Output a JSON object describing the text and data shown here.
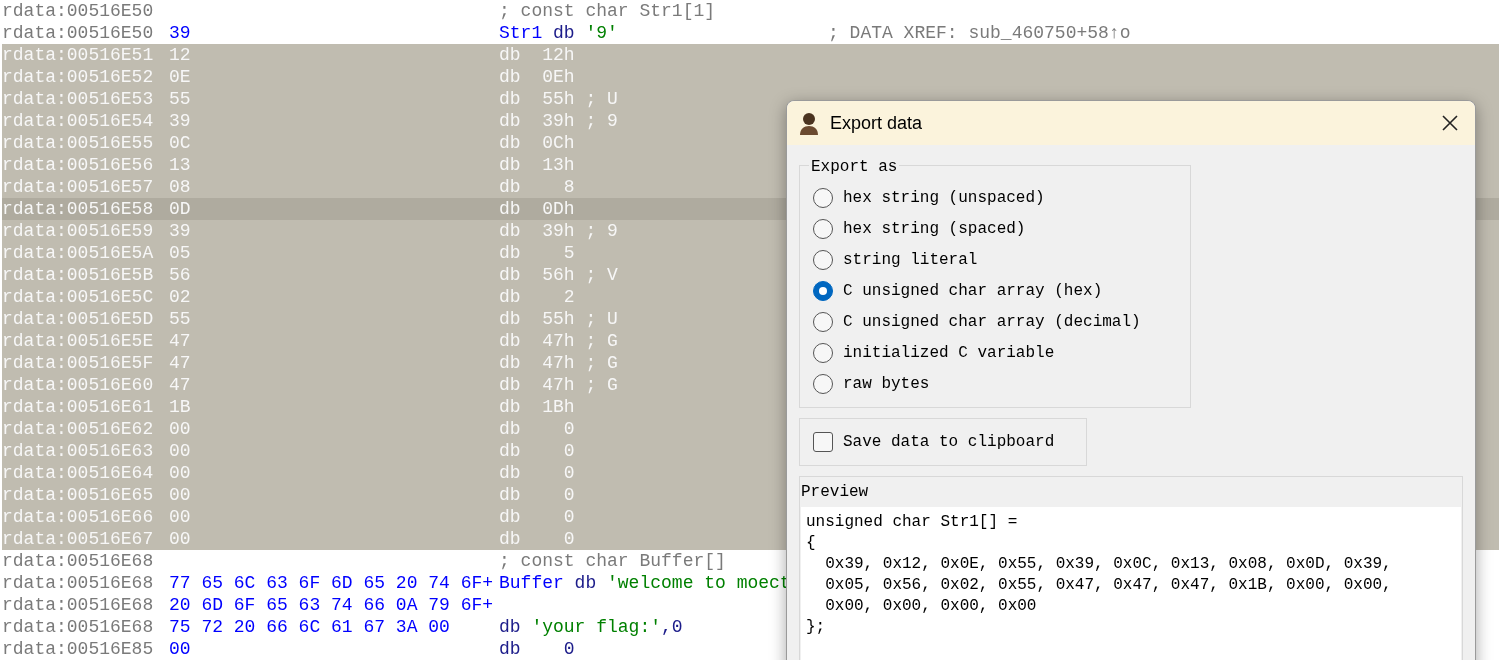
{
  "listing": {
    "rows": [
      {
        "kind": "comment",
        "address": "rdata:00516E50",
        "comment": "; const char Str1[1]",
        "selected": false,
        "current": false
      },
      {
        "kind": "labeled",
        "address": "rdata:00516E50",
        "bytes": "39",
        "label": "Str1",
        "directive": "db",
        "tokens": [
          {
            "text": "'9'",
            "kind": "string"
          }
        ],
        "xref": "; DATA XREF: sub_460750+58↑o",
        "selected": false,
        "current": false
      },
      {
        "kind": "byte",
        "address": "rdata:00516E51",
        "bytes": "12",
        "directive": "db",
        "operand": "12h",
        "selected": true,
        "current": false
      },
      {
        "kind": "byte",
        "address": "rdata:00516E52",
        "bytes": "0E",
        "directive": "db",
        "operand": "0Eh",
        "selected": true,
        "current": false
      },
      {
        "kind": "byte",
        "address": "rdata:00516E53",
        "bytes": "55",
        "directive": "db",
        "operand": "55h",
        "comment": "; U",
        "selected": true,
        "current": false
      },
      {
        "kind": "byte",
        "address": "rdata:00516E54",
        "bytes": "39",
        "directive": "db",
        "operand": "39h",
        "comment": "; 9",
        "selected": true,
        "current": false
      },
      {
        "kind": "byte",
        "address": "rdata:00516E55",
        "bytes": "0C",
        "directive": "db",
        "operand": "0Ch",
        "selected": true,
        "current": false
      },
      {
        "kind": "byte",
        "address": "rdata:00516E56",
        "bytes": "13",
        "directive": "db",
        "operand": "13h",
        "selected": true,
        "current": false
      },
      {
        "kind": "byte",
        "address": "rdata:00516E57",
        "bytes": "08",
        "directive": "db",
        "operand": "8",
        "selected": true,
        "current": false
      },
      {
        "kind": "byte",
        "address": "rdata:00516E58",
        "bytes": "0D",
        "directive": "db",
        "operand": "0Dh",
        "selected": true,
        "current": true
      },
      {
        "kind": "byte",
        "address": "rdata:00516E59",
        "bytes": "39",
        "directive": "db",
        "operand": "39h",
        "comment": "; 9",
        "selected": true,
        "current": false
      },
      {
        "kind": "byte",
        "address": "rdata:00516E5A",
        "bytes": "05",
        "directive": "db",
        "operand": "5",
        "selected": true,
        "current": false
      },
      {
        "kind": "byte",
        "address": "rdata:00516E5B",
        "bytes": "56",
        "directive": "db",
        "operand": "56h",
        "comment": "; V",
        "selected": true,
        "current": false
      },
      {
        "kind": "byte",
        "address": "rdata:00516E5C",
        "bytes": "02",
        "directive": "db",
        "operand": "2",
        "selected": true,
        "current": false
      },
      {
        "kind": "byte",
        "address": "rdata:00516E5D",
        "bytes": "55",
        "directive": "db",
        "operand": "55h",
        "comment": "; U",
        "selected": true,
        "current": false
      },
      {
        "kind": "byte",
        "address": "rdata:00516E5E",
        "bytes": "47",
        "directive": "db",
        "operand": "47h",
        "comment": "; G",
        "selected": true,
        "current": false
      },
      {
        "kind": "byte",
        "address": "rdata:00516E5F",
        "bytes": "47",
        "directive": "db",
        "operand": "47h",
        "comment": "; G",
        "selected": true,
        "current": false
      },
      {
        "kind": "byte",
        "address": "rdata:00516E60",
        "bytes": "47",
        "directive": "db",
        "operand": "47h",
        "comment": "; G",
        "selected": true,
        "current": false
      },
      {
        "kind": "byte",
        "address": "rdata:00516E61",
        "bytes": "1B",
        "directive": "db",
        "operand": "1Bh",
        "selected": true,
        "current": false
      },
      {
        "kind": "byte",
        "address": "rdata:00516E62",
        "bytes": "00",
        "directive": "db",
        "operand": "0",
        "selected": true,
        "current": false
      },
      {
        "kind": "byte",
        "address": "rdata:00516E63",
        "bytes": "00",
        "directive": "db",
        "operand": "0",
        "selected": true,
        "current": false
      },
      {
        "kind": "byte",
        "address": "rdata:00516E64",
        "bytes": "00",
        "directive": "db",
        "operand": "0",
        "selected": true,
        "current": false
      },
      {
        "kind": "byte",
        "address": "rdata:00516E65",
        "bytes": "00",
        "directive": "db",
        "operand": "0",
        "selected": true,
        "current": false
      },
      {
        "kind": "byte",
        "address": "rdata:00516E66",
        "bytes": "00",
        "directive": "db",
        "operand": "0",
        "selected": true,
        "current": false
      },
      {
        "kind": "byte",
        "address": "rdata:00516E67",
        "bytes": "00",
        "directive": "db",
        "operand": "0",
        "selected": true,
        "current": false
      },
      {
        "kind": "comment",
        "address": "rdata:00516E68",
        "comment": "; const char Buffer[]",
        "selected": false,
        "current": false
      },
      {
        "kind": "labeled",
        "address": "rdata:00516E68",
        "bytes": "77 65 6C 63 6F 6D 65 20 74 6F+",
        "label": "Buffer",
        "directive": "db",
        "tokens": [
          {
            "text": "'welcome to moect",
            "kind": "string"
          }
        ],
        "selected": false,
        "current": false
      },
      {
        "kind": "bytes",
        "address": "rdata:00516E68",
        "bytes": "20 6D 6F 65 63 74 66 0A 79 6F+",
        "selected": false,
        "current": false
      },
      {
        "kind": "data",
        "address": "rdata:00516E68",
        "bytes": "75 72 20 66 6C 61 67 3A 00",
        "directive": "db",
        "tokens": [
          {
            "text": "'your flag:'",
            "kind": "string"
          },
          {
            "text": ",0",
            "kind": "plain"
          }
        ],
        "selected": false,
        "current": false
      },
      {
        "kind": "byte",
        "address": "rdata:00516E85",
        "bytes": "00",
        "directive": "db",
        "operand": "0",
        "selected": false,
        "current": false
      }
    ]
  },
  "dialog": {
    "title": "Export data",
    "export_group": {
      "title": "Export as",
      "options": [
        {
          "label": "hex string (unspaced)",
          "selected": false
        },
        {
          "label": "hex string (spaced)",
          "selected": false
        },
        {
          "label": "string literal",
          "selected": false
        },
        {
          "label": "C unsigned char array (hex)",
          "selected": true
        },
        {
          "label": "C unsigned char array (decimal)",
          "selected": false
        },
        {
          "label": "initialized C variable",
          "selected": false
        },
        {
          "label": "raw bytes",
          "selected": false
        }
      ]
    },
    "clipboard": {
      "label": "Save data to clipboard",
      "checked": false
    },
    "preview": {
      "label": "Preview",
      "lines": [
        "unsigned char Str1[] =",
        "{",
        "  0x39, 0x12, 0x0E, 0x55, 0x39, 0x0C, 0x13, 0x08, 0x0D, 0x39,",
        "  0x05, 0x56, 0x02, 0x55, 0x47, 0x47, 0x47, 0x1B, 0x00, 0x00,",
        "  0x00, 0x00, 0x00, 0x00",
        "};"
      ]
    }
  }
}
